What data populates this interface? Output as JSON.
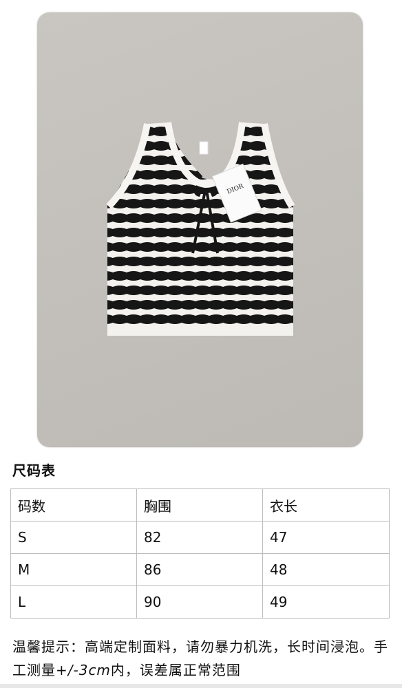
{
  "product_image": {
    "tag_brand": "DIOR",
    "colors": {
      "stripe_dark": "#161616",
      "stripe_light": "#f4f2ee",
      "background": "#c6c3be"
    }
  },
  "size_chart": {
    "title": "尺码表",
    "headers": [
      "码数",
      "胸围",
      "衣长"
    ],
    "rows": [
      [
        "S",
        "82",
        "47"
      ],
      [
        "M",
        "86",
        "48"
      ],
      [
        "L",
        "90",
        "49"
      ]
    ]
  },
  "notice": {
    "text_a": "温馨提示：高端定制面料，请勿暴力机洗，长时间浸泡。手工测量",
    "measure": "+/-3cm",
    "text_b": "内，误差属正常范围"
  }
}
